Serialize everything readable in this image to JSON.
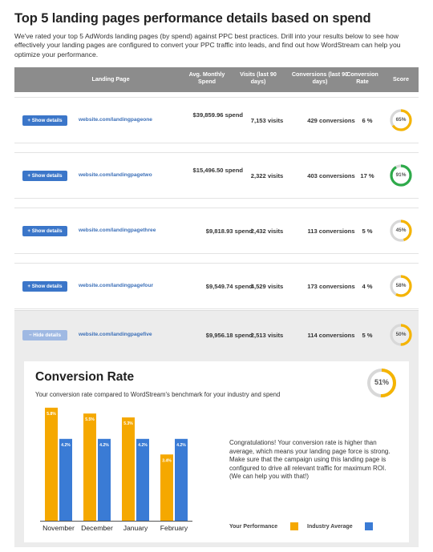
{
  "page": {
    "title": "Top 5 landing pages performance details based on spend",
    "intro": "We've rated your top 5 AdWords landing pages (by spend) against PPC best practices. Drill into your results below to see how effectively your landing pages are configured to convert your PPC traffic into leads, and find out how WordStream can help you optimize your performance."
  },
  "table": {
    "headers": {
      "landing_page": "Landing Page",
      "spend": "Avg. Monthly Spend",
      "visits": "Visits (last 90 days)",
      "conversions": "Conversions (last 90 days)",
      "rate": "Conversion Rate",
      "score": "Score"
    },
    "rows": [
      {
        "button": "+ Show details",
        "url": "website.com/landingpageone",
        "spend": "$39,859.96 spend",
        "visits": "7,153 visits",
        "conversions": "429 conversions",
        "rate": "6 %",
        "score": "65%",
        "score_value": 65,
        "score_color": "#f5b400"
      },
      {
        "button": "+ Show details",
        "url": "website.com/landingpagetwo",
        "spend": "$15,496.50 spend",
        "visits": "2,322 visits",
        "conversions": "403 conversions",
        "rate": "17 %",
        "score": "91%",
        "score_value": 91,
        "score_color": "#2eaa4a"
      },
      {
        "button": "+ Show details",
        "url": "website.com/landingpagethree",
        "spend": "$9,818.93 spend",
        "visits": "2,432 visits",
        "conversions": "113 conversions",
        "rate": "5 %",
        "score": "45%",
        "score_value": 45,
        "score_color": "#f5b400"
      },
      {
        "button": "+ Show details",
        "url": "website.com/landingpagefour",
        "spend": "$9,549.74 spend",
        "visits": "4,529 visits",
        "conversions": "173 conversions",
        "rate": "4 %",
        "score": "58%",
        "score_value": 58,
        "score_color": "#f5b400"
      },
      {
        "button": "− Hide details",
        "url": "website.com/landingpagefive",
        "spend": "$9,956.18 spend",
        "visits": "2,513 visits",
        "conversions": "114 conversions",
        "rate": "5 %",
        "score": "50%",
        "score_value": 50,
        "score_color": "#f5b400"
      }
    ]
  },
  "details": {
    "title": "Conversion Rate",
    "subtitle": "Your conversion rate compared to WordStream's benchmark for your industry and spend",
    "gauge_label": "51%",
    "gauge_value": 51,
    "gauge_color": "#f5b400",
    "congrats": "Congratulations! Your conversion rate is higher than average, which means your landing page force is strong. Make sure that the campaign using this landing page is configured to drive all relevant traffic for maximum ROI. (We can help you with that!)",
    "legend": {
      "performance": "Your Performance",
      "average": "Industry Average",
      "performance_color": "#f5a800",
      "average_color": "#3a7bd5"
    }
  },
  "chart_data": {
    "type": "bar",
    "categories": [
      "November",
      "December",
      "January",
      "February"
    ],
    "series": [
      {
        "name": "Your Performance",
        "values": [
          5.8,
          5.5,
          5.3,
          3.4
        ],
        "labels": [
          "5.8%",
          "5.5%",
          "5.3%",
          "3.4%"
        ],
        "color": "#f5a800"
      },
      {
        "name": "Industry Average",
        "values": [
          4.2,
          4.2,
          4.2,
          4.2
        ],
        "labels": [
          "4.2%",
          "4.2%",
          "4.2%",
          "4.2%"
        ],
        "color": "#3a7bd5"
      }
    ],
    "ylim": [
      0,
      6
    ]
  }
}
